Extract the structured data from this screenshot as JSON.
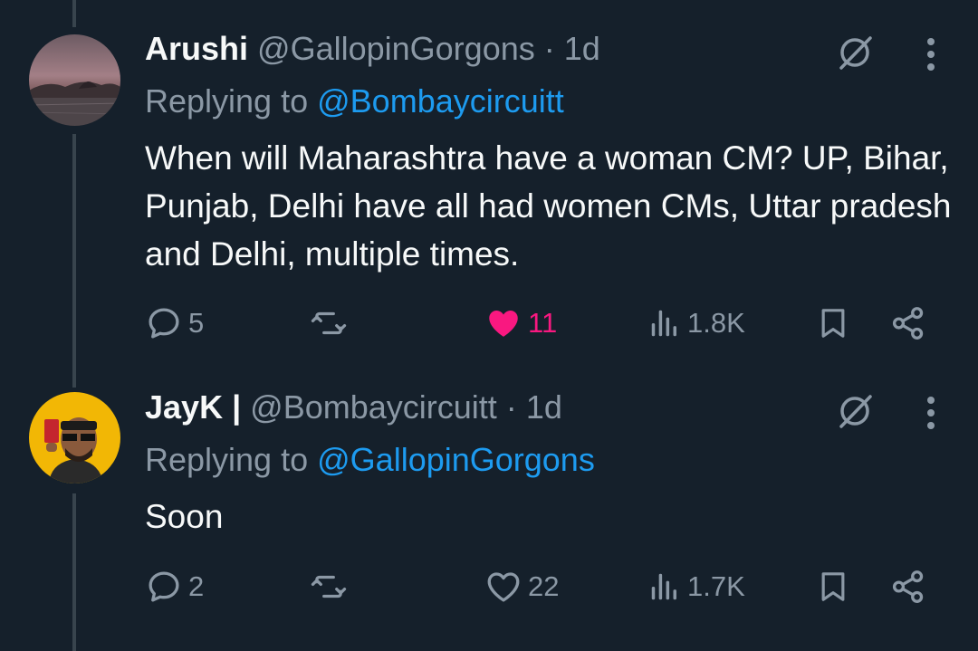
{
  "colors": {
    "background": "#15202b",
    "text_primary": "#f7f9f9",
    "text_secondary": "#8b98a5",
    "link": "#1d9bf0",
    "like_active": "#f91880",
    "thread_line": "#38444d"
  },
  "tweets": [
    {
      "display_name": "Arushi",
      "handle": "@GallopinGorgons",
      "separator": "·",
      "time": "1d",
      "replying_prefix": "Replying to",
      "replying_to": "@Bombaycircuitt",
      "text": "When will Maharashtra have a woman CM? UP, Bihar, Punjab, Delhi have all had women CMs, Uttar pradesh and Delhi, multiple times.",
      "reply_count": "5",
      "retweet_count": "",
      "like_count": "11",
      "liked": true,
      "view_count": "1.8K",
      "icons": [
        "grok-icon",
        "more-icon",
        "reply-icon",
        "retweet-icon",
        "like-icon",
        "views-icon",
        "bookmark-icon",
        "share-icon"
      ]
    },
    {
      "display_name": "JayK |",
      "handle": "@Bombaycircuitt",
      "separator": "·",
      "time": "1d",
      "replying_prefix": "Replying to",
      "replying_to": "@GallopinGorgons",
      "text": "Soon",
      "reply_count": "2",
      "retweet_count": "",
      "like_count": "22",
      "liked": false,
      "view_count": "1.7K",
      "icons": [
        "grok-icon",
        "more-icon",
        "reply-icon",
        "retweet-icon",
        "like-icon",
        "views-icon",
        "bookmark-icon",
        "share-icon"
      ]
    }
  ]
}
